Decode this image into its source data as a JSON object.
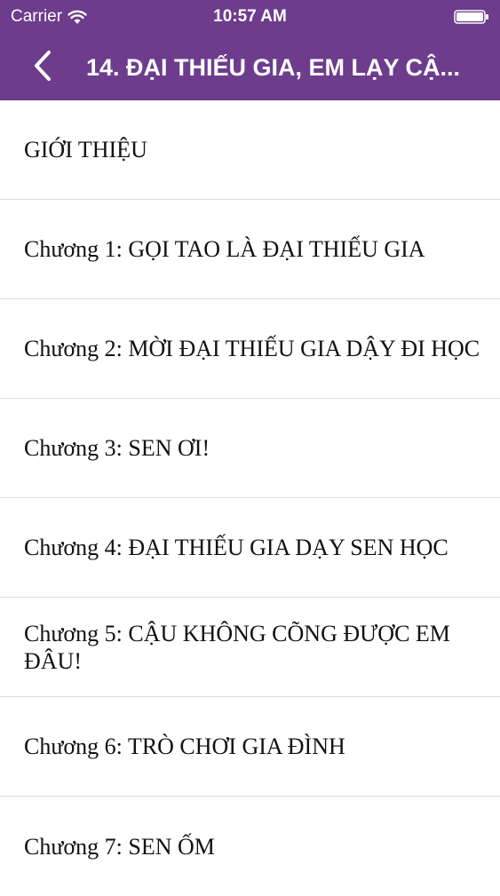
{
  "status_bar": {
    "carrier": "Carrier",
    "time": "10:57 AM",
    "wifi_icon": "wifi-icon",
    "battery_icon": "battery-icon"
  },
  "nav": {
    "back_icon": "chevron-left-icon",
    "title": "14. ĐẠI THIẾU GIA, EM LẠY CẬ..."
  },
  "chapters": [
    {
      "label": "GIỚI THIỆU"
    },
    {
      "label": "Chương 1: GỌI TAO LÀ ĐẠI THIẾU GIA"
    },
    {
      "label": "Chương 2: MỜI ĐẠI THIẾU GIA DẬY ĐI HỌC"
    },
    {
      "label": "Chương 3: SEN ƠI!"
    },
    {
      "label": "Chương 4: ĐẠI THIẾU GIA DẠY SEN HỌC"
    },
    {
      "label": "Chương 5: CẬU KHÔNG CÕNG ĐƯỢC EM ĐÂU!"
    },
    {
      "label": "Chương 6: TRÒ CHƠI GIA ĐÌNH"
    },
    {
      "label": "Chương 7: SEN ỐM"
    }
  ],
  "colors": {
    "header_background": "#6d3c8c",
    "header_text": "#ffffff",
    "separator": "#dcdcdc",
    "item_text": "#111111"
  }
}
